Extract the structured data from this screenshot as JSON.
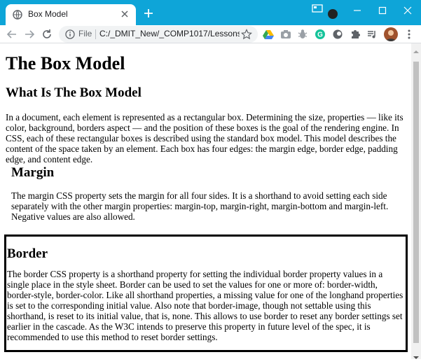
{
  "browser": {
    "tab_title": "Box Model",
    "omnibox_label": "File",
    "url": "C:/_DMIT_New/_COMP1017/Lessons/...",
    "icons": [
      "globe-icon",
      "close-icon",
      "new-tab-icon",
      "minimize-icon",
      "maximize-icon",
      "window-close-icon",
      "back-icon",
      "forward-icon",
      "reload-icon",
      "info-icon",
      "star-icon",
      "drive-icon",
      "camera-icon",
      "bug-icon",
      "grammarly-icon",
      "circle-extension-icon",
      "puzzle-icon",
      "media-icon",
      "avatar",
      "more-icon"
    ]
  },
  "page": {
    "title": "The Box Model",
    "what_heading": "What Is The Box Model",
    "what_text": "In a document, each element is represented as a rectangular box. Determining the size, properties — like its color, background, borders aspect — and the position of these boxes is the goal of the rendering engine. In CSS, each of these rectangular boxes is described using the standard box model. This model describes the content of the space taken by an element. Each box has four edges: the margin edge, border edge, padding edge, and content edge.",
    "margin_heading": "Margin",
    "margin_text": "The margin CSS property sets the margin for all four sides. It is a shorthand to avoid setting each side separately with the other margin properties: margin-top, margin-right, margin-bottom and margin-left. Negative values are also allowed.",
    "border_heading": "Border",
    "border_text": "The border CSS property is a shorthand property for setting the individual border property values in a single place in the style sheet. Border can be used to set the values for one or more of: border-width, border-style, border-color. Like all shorthand properties, a missing value for one of the longhand properties is set to the corresponding initial value. Also note that border-image, though not settable using this shorthand, is reset to its initial value, that is, none. This allows to use border to reset any border settings set earlier in the cascade. As the W3C intends to preserve this property in future level of the spec, it is recommended to use this method to reset border settings."
  }
}
